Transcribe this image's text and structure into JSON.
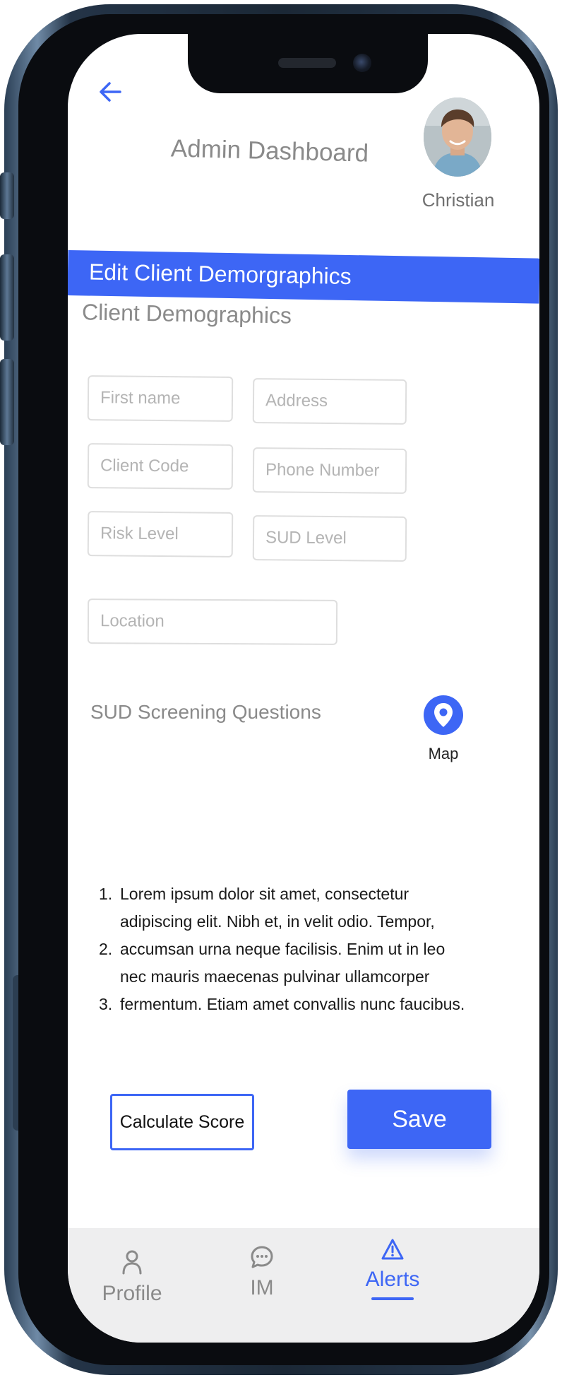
{
  "header": {
    "title": "Admin Dashboard",
    "user_name": "Christian"
  },
  "banner": {
    "title": "Edit Client Demorgraphics"
  },
  "demographics": {
    "section_title": "Client Demographics",
    "fields": {
      "first_name": {
        "placeholder": "First name",
        "value": ""
      },
      "address": {
        "placeholder": "Address",
        "value": ""
      },
      "client_code": {
        "placeholder": "Client Code",
        "value": ""
      },
      "phone_number": {
        "placeholder": "Phone Number",
        "value": ""
      },
      "risk_level": {
        "placeholder": "Risk Level",
        "value": ""
      },
      "sud_level": {
        "placeholder": "SUD Level",
        "value": ""
      },
      "location": {
        "placeholder": "Location",
        "value": ""
      }
    },
    "map_label": "Map"
  },
  "screening": {
    "section_title": "SUD Screening Questions",
    "questions": [
      {
        "num": "1.",
        "text": "Lorem ipsum dolor sit amet, consectetur adipiscing elit. Nibh et, in velit odio. Tempor,"
      },
      {
        "num": "2.",
        "text": "accumsan urna neque facilisis. Enim ut in leo nec mauris maecenas pulvinar ullamcorper"
      },
      {
        "num": "3.",
        "text": "fermentum. Etiam amet convallis nunc faucibus."
      }
    ]
  },
  "actions": {
    "calculate_label": "Calculate Score",
    "save_label": "Save"
  },
  "bottom_nav": {
    "items": [
      {
        "label": "Profile",
        "icon": "person-icon"
      },
      {
        "label": "IM",
        "icon": "chat-bubble-icon"
      },
      {
        "label": "Alerts",
        "icon": "warning-triangle-icon",
        "active": true
      }
    ]
  },
  "colors": {
    "accent": "#3d66f5",
    "muted_text": "#8a8a8a",
    "nav_background": "#eeeeef"
  }
}
